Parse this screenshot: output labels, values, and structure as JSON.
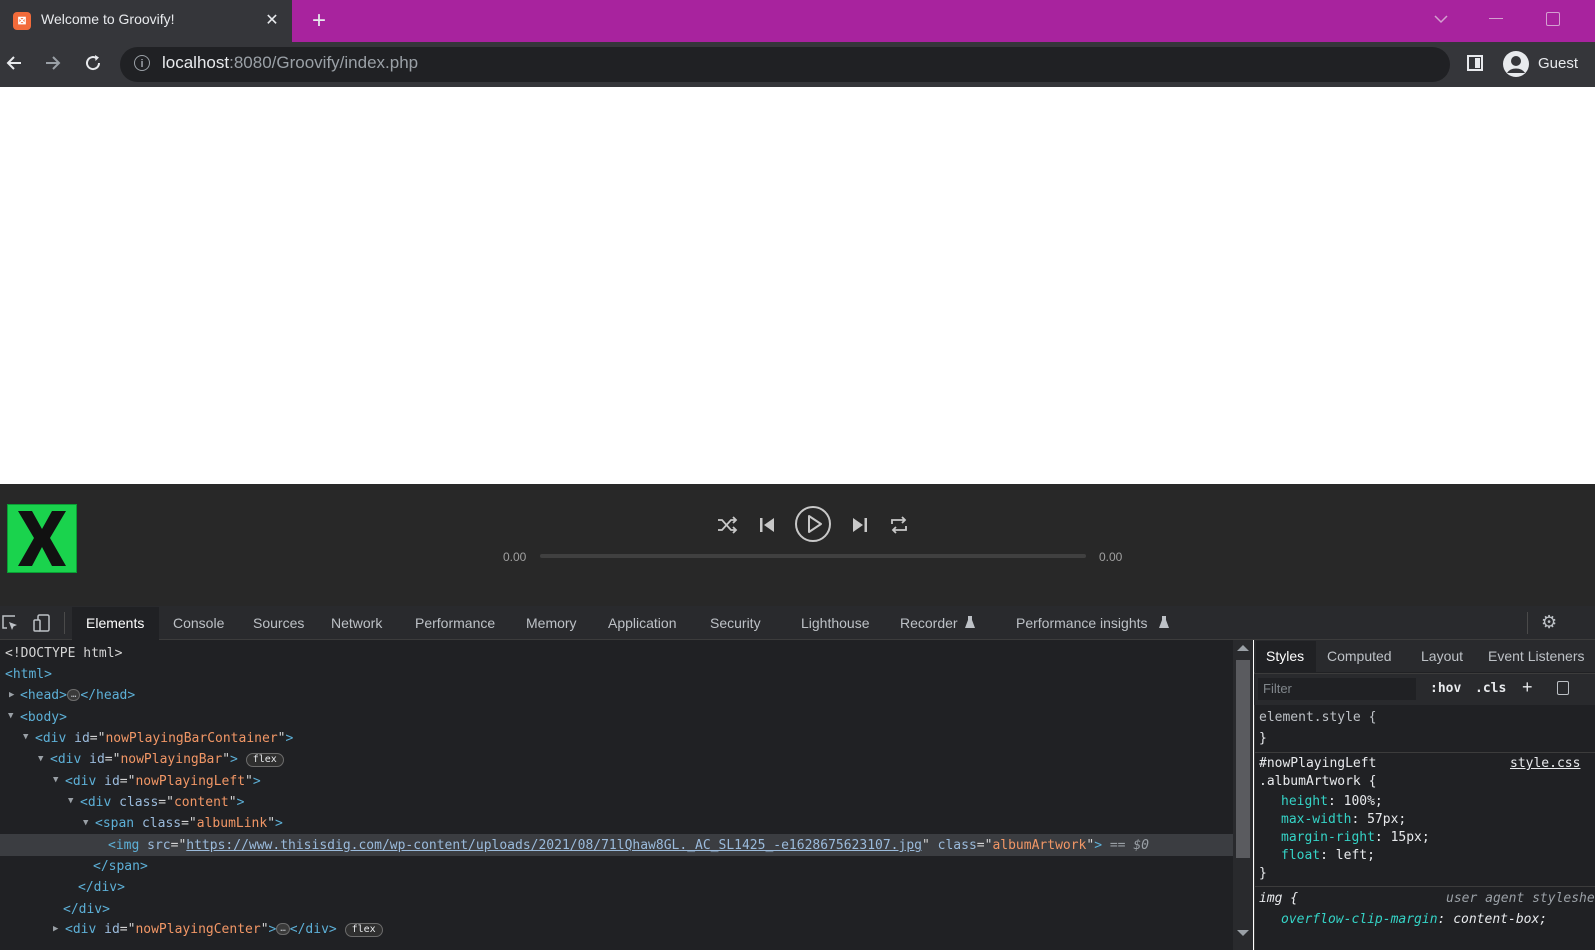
{
  "browser": {
    "tab_title": "Welcome to Groovify!",
    "tab_close": "✕",
    "new_tab": "+",
    "url_host": "localhost",
    "url_path": ":8080/Groovify/index.php",
    "profile_label": "Guest",
    "colors": {
      "titlebar": "#a8239e",
      "toolbar": "#35363a"
    }
  },
  "player": {
    "album_art_letter": "X",
    "album_art_color": "#1ad34d",
    "time_current": "0.00",
    "time_total": "0.00",
    "progress_fraction": 0
  },
  "devtools": {
    "tabs": [
      "Elements",
      "Console",
      "Sources",
      "Network",
      "Performance",
      "Memory",
      "Application",
      "Security",
      "Lighthouse",
      "Recorder",
      "Performance insights"
    ],
    "elements": {
      "doctype": "<!DOCTYPE html>",
      "html_open": "<html>",
      "head_open": "<head>",
      "head_close": "</head>",
      "body_open": "<body>",
      "div": "div",
      "span": "span",
      "img": "img",
      "id_attr": "id",
      "class_attr": "class",
      "src_attr": "src",
      "container_id": "nowPlayingBarContainer",
      "bar_id": "nowPlayingBar",
      "left_id": "nowPlayingLeft",
      "content_class": "content",
      "album_link_class": "albumLink",
      "img_src": "https://www.thisisdig.com/wp-content/uploads/2021/08/71lQhaw8GL._AC_SL1425_-e1628675623107.jpg",
      "img_class": "albumArtwork",
      "selected_marker": "== $0",
      "span_close": "</span>",
      "div_close": "</div>",
      "center_id": "nowPlayingCenter",
      "flex_badge": "flex",
      "ellipsis": "…"
    },
    "styles": {
      "tabs": [
        "Styles",
        "Computed",
        "Layout",
        "Event Listeners"
      ],
      "filter_placeholder": "Filter",
      "hov": ":hov",
      "cls": ".cls",
      "element_style": "element.style {",
      "close_brace": "}",
      "rule1_selector_a": "#nowPlayingLeft",
      "rule1_selector_b": ".albumArtwork {",
      "rule1_source": "style.css",
      "rule1_props": [
        {
          "name": "height",
          "value": "100%;"
        },
        {
          "name": "max-width",
          "value": "57px;"
        },
        {
          "name": "margin-right",
          "value": "15px;"
        },
        {
          "name": "float",
          "value": "left;"
        }
      ],
      "rule2_selector": "img {",
      "rule2_source": "user agent stylesheet",
      "rule2_prop_name": "overflow-clip-margin",
      "rule2_prop_value": "content-box;"
    }
  }
}
